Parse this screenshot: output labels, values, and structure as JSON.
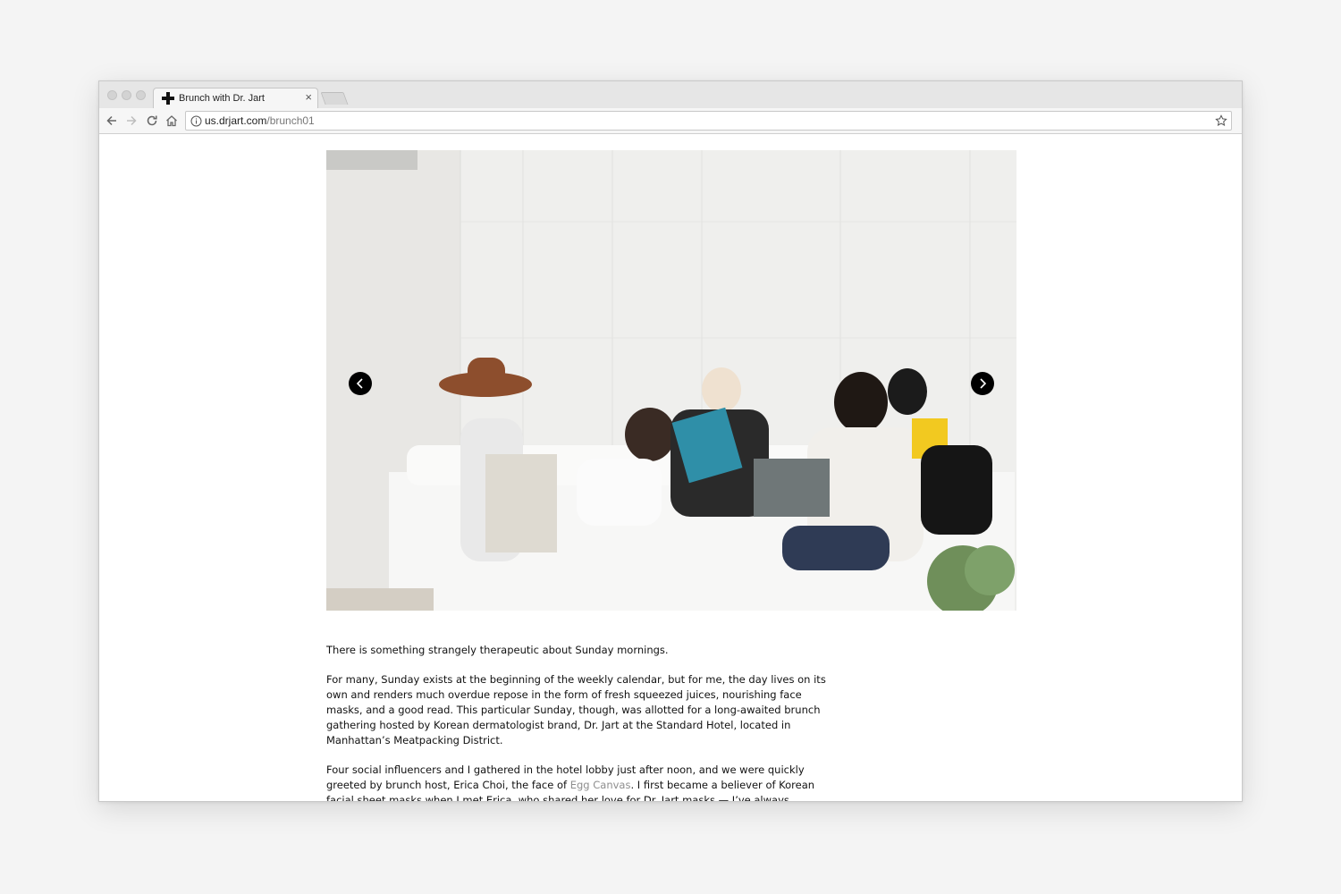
{
  "browser": {
    "tab": {
      "title": "Brunch with Dr. Jart",
      "close_symbol": "×"
    },
    "address": {
      "domain": "us.drjart.com",
      "path": "/brunch01"
    },
    "icons": {
      "back": "arrow-left-icon",
      "forward": "arrow-right-icon",
      "reload": "reload-icon",
      "home": "home-icon",
      "site_info": "info-icon",
      "bookmark": "star-icon",
      "favicon": "plus-cross-icon"
    }
  },
  "hero": {
    "icons": {
      "prev": "chevron-left-icon",
      "next": "chevron-right-icon"
    }
  },
  "article": {
    "p1": "There is something strangely therapeutic about Sunday mornings.",
    "p2": "For many, Sunday exists at the beginning of the weekly calendar, but for me, the day lives on its own and renders much overdue repose in the form of fresh squeezed juices, nourishing face masks, and a good read. This particular Sunday, though, was allotted for a long-awaited brunch gathering hosted by Korean dermatologist brand, Dr. Jart at the Standard Hotel, located in Manhattan’s Meatpacking District.",
    "p3_before": "Four social influencers and I gathered in the hotel lobby just after noon, and we were quickly greeted by brunch host, Erica Choi, the face of ",
    "p3_link": "Egg Canvas",
    "p3_after": ". I first became a believer of Korean facial sheet masks when I met Erica, who shared her love for Dr. Jart masks — I’ve always openly"
  },
  "colors": {
    "page_bg": "#f4f4f4",
    "link": "#8e8e8e",
    "text": "#111111",
    "carousel_button": "#000000"
  }
}
